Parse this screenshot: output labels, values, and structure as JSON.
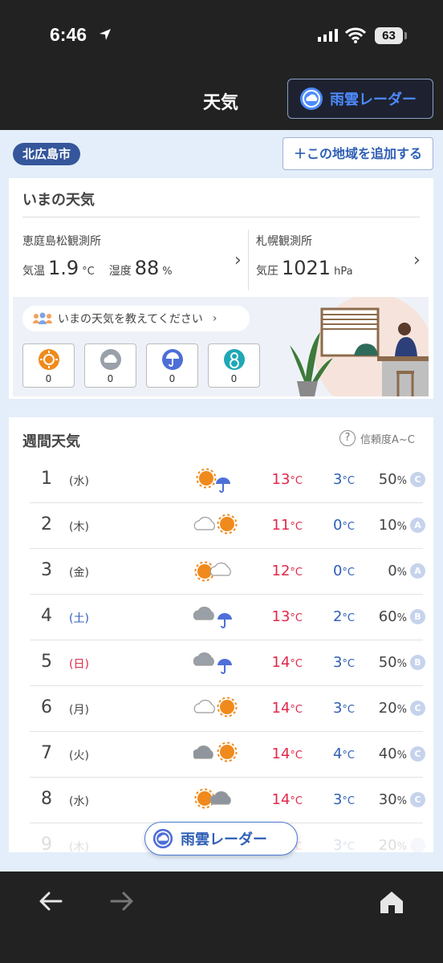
{
  "status_bar": {
    "time": "6:46",
    "battery": "63"
  },
  "header": {
    "title": "天気",
    "radar_button": "雨雲レーダー"
  },
  "location": {
    "city": "北広島市",
    "add_button": "＋この地域を追加する"
  },
  "current": {
    "title": "いまの天気",
    "station_left": {
      "name": "恵庭島松観測所",
      "temp_label": "気温",
      "temp_value": "1.9",
      "temp_unit": "°C",
      "humidity_label": "湿度",
      "humidity_value": "88",
      "humidity_unit": "%"
    },
    "station_right": {
      "name": "札幌観測所",
      "pressure_label": "気圧",
      "pressure_value": "1021",
      "pressure_unit": "hPa"
    },
    "report_prompt": "いまの天気を教えてください",
    "reports": [
      {
        "icon": "sunny-icon",
        "count": "0"
      },
      {
        "icon": "cloudy-icon",
        "count": "0"
      },
      {
        "icon": "rain-icon",
        "count": "0"
      },
      {
        "icon": "snow-icon",
        "count": "0"
      }
    ]
  },
  "weekly": {
    "title": "週間天気",
    "reliability": "信頼度A~C",
    "days": [
      {
        "day": "1",
        "weekday": "(水)",
        "type": "weekday",
        "icon": "sun-rain-icon",
        "high": "13",
        "low": "3",
        "pop": "50",
        "grade": "C"
      },
      {
        "day": "2",
        "weekday": "(木)",
        "type": "weekday",
        "icon": "cloud-sun-icon",
        "high": "11",
        "low": "0",
        "pop": "10",
        "grade": "A"
      },
      {
        "day": "3",
        "weekday": "(金)",
        "type": "weekday",
        "icon": "sun-cloud-icon",
        "high": "12",
        "low": "0",
        "pop": "0",
        "grade": "A"
      },
      {
        "day": "4",
        "weekday": "(土)",
        "type": "sat",
        "icon": "cloud-rain-icon",
        "high": "13",
        "low": "2",
        "pop": "60",
        "grade": "B"
      },
      {
        "day": "5",
        "weekday": "(日)",
        "type": "sun",
        "icon": "cloud-rain-icon",
        "high": "14",
        "low": "3",
        "pop": "50",
        "grade": "B"
      },
      {
        "day": "6",
        "weekday": "(月)",
        "type": "weekday",
        "icon": "cloud-sun-icon",
        "high": "14",
        "low": "3",
        "pop": "20",
        "grade": "C"
      },
      {
        "day": "7",
        "weekday": "(火)",
        "type": "weekday",
        "icon": "darkcloud-sun-icon",
        "high": "14",
        "low": "4",
        "pop": "40",
        "grade": "C"
      },
      {
        "day": "8",
        "weekday": "(水)",
        "type": "weekday",
        "icon": "sun-darkcloud-icon",
        "high": "14",
        "low": "3",
        "pop": "30",
        "grade": "C"
      },
      {
        "day": "9",
        "weekday": "(木)",
        "type": "weekday",
        "icon": "cloud-sun-icon",
        "high": "",
        "low": "3",
        "pop": "20",
        "grade": ""
      }
    ],
    "temp_unit": "°C",
    "pop_unit": "%"
  },
  "fab": {
    "label": "雨雲レーダー"
  },
  "colors": {
    "high": "#e0294a",
    "low": "#2f5fb5",
    "sun": "#f08a1d",
    "accent": "#2f5fb5"
  }
}
